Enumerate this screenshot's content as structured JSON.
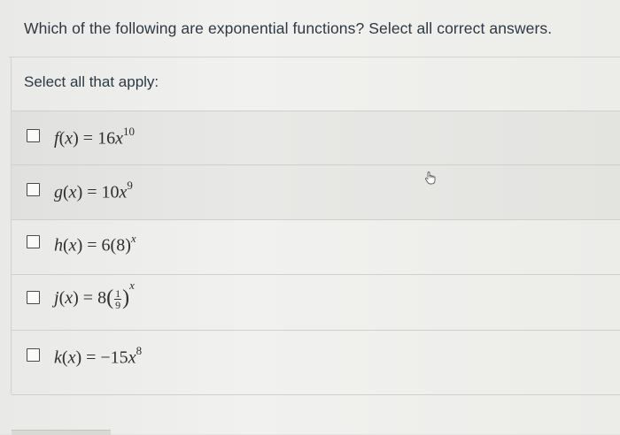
{
  "question": {
    "text": "Which of the following are exponential functions? Select all correct answers."
  },
  "instructions": {
    "text": "Select all that apply:"
  },
  "options": [
    {
      "name": "f",
      "lhs": "f",
      "var": "x",
      "coeff": "16",
      "base": "x",
      "exponent": "10",
      "checked": false
    },
    {
      "name": "g",
      "lhs": "g",
      "var": "x",
      "coeff": "10",
      "base": "x",
      "exponent": "9",
      "checked": false
    },
    {
      "name": "h",
      "lhs": "h",
      "var": "x",
      "coeff": "6",
      "base": "8",
      "exponent": "x",
      "checked": false
    },
    {
      "name": "j",
      "lhs": "j",
      "var": "x",
      "coeff": "8",
      "frac_num": "1",
      "frac_den": "9",
      "exponent": "x",
      "checked": false
    },
    {
      "name": "k",
      "lhs": "k",
      "var": "x",
      "coeff": "−15",
      "base": "x",
      "exponent": "8",
      "checked": false
    }
  ],
  "cursor": {
    "icon": "hand-pointer-icon"
  }
}
